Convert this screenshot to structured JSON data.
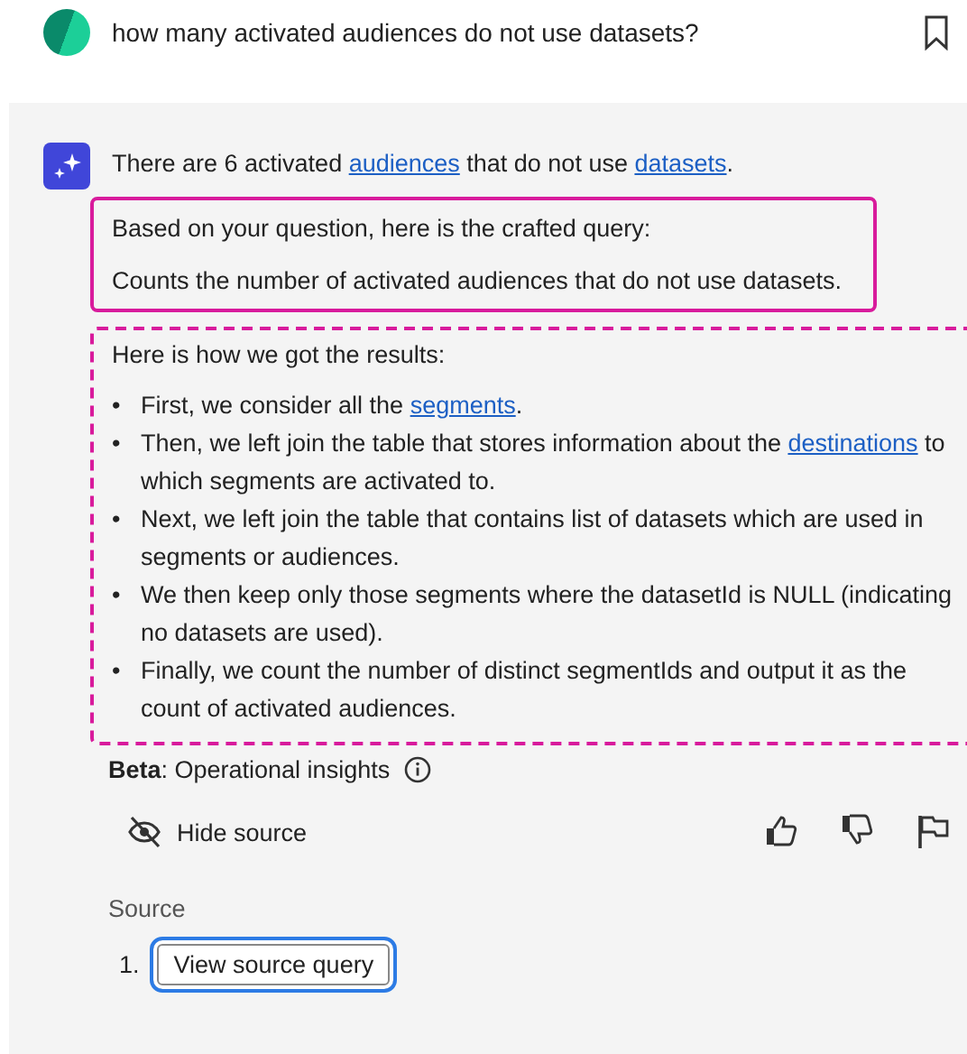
{
  "question": {
    "text": "how many activated audiences do not use datasets?"
  },
  "answer": {
    "parts": [
      {
        "text": "There are 6 activated ",
        "kind": "text"
      },
      {
        "text": "audiences",
        "kind": "link"
      },
      {
        "text": " that do not use ",
        "kind": "text"
      },
      {
        "text": "datasets",
        "kind": "link"
      },
      {
        "text": ".",
        "kind": "text"
      }
    ]
  },
  "query_box": {
    "heading": "Based on your question, here is the crafted query:",
    "description": "Counts the number of activated audiences that do not use datasets."
  },
  "steps": {
    "heading": "Here is how we got the results:",
    "items": [
      {
        "bullet": "•",
        "parts": [
          {
            "text": "First, we consider all the ",
            "kind": "text"
          },
          {
            "text": "segments",
            "kind": "link"
          },
          {
            "text": ".",
            "kind": "text"
          }
        ]
      },
      {
        "bullet": "•",
        "parts": [
          {
            "text": "Then, we left join the table that stores information about the ",
            "kind": "text"
          },
          {
            "text": "destinations",
            "kind": "link"
          },
          {
            "text": " to which segments are activated to.",
            "kind": "text"
          }
        ]
      },
      {
        "bullet": "•",
        "parts": [
          {
            "text": "Next, we left join the table that contains list of datasets which are used in segments or audiences.",
            "kind": "text"
          }
        ]
      },
      {
        "bullet": "•",
        "parts": [
          {
            "text": "We then keep only those segments where the datasetId is NULL (indicating no datasets are used).",
            "kind": "text"
          }
        ]
      },
      {
        "bullet": "•",
        "parts": [
          {
            "text": "Finally, we count the number of distinct segmentIds and output it as the count of activated audiences.",
            "kind": "text"
          }
        ]
      }
    ]
  },
  "beta": {
    "text": "**Beta**: Operational insights"
  },
  "hide_source": {
    "label": "Hide source"
  },
  "source": {
    "label": "Source",
    "items": [
      {
        "number": "1.",
        "button": "View source query",
        "focused": true
      }
    ]
  }
}
